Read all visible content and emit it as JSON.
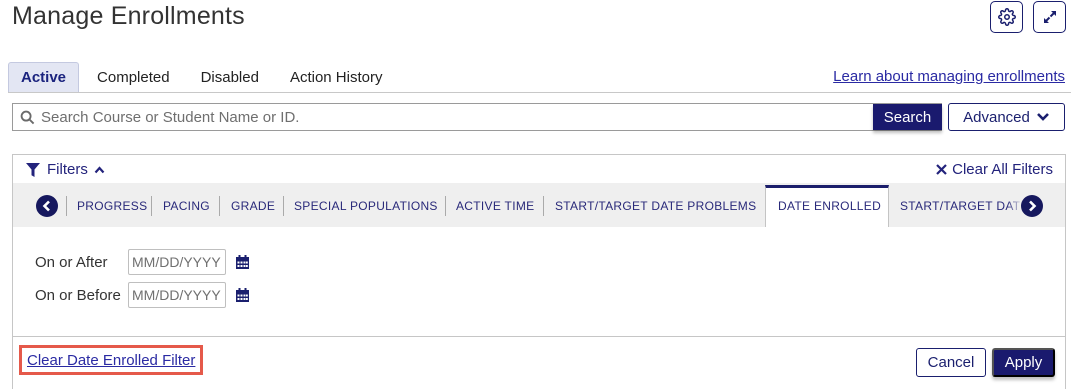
{
  "page": {
    "title": "Manage Enrollments"
  },
  "header_icons": {
    "settings": "gear-icon",
    "expand": "expand-icon"
  },
  "tabs": [
    {
      "label": "Active",
      "active": true
    },
    {
      "label": "Completed",
      "active": false
    },
    {
      "label": "Disabled",
      "active": false
    },
    {
      "label": "Action History",
      "active": false
    }
  ],
  "learn_link": "Learn about managing enrollments",
  "search": {
    "placeholder": "Search Course or Student Name or ID.",
    "value": "",
    "button_label": "Search",
    "advanced_label": "Advanced"
  },
  "filters": {
    "toggle_label": "Filters",
    "expanded": true,
    "clear_all_label": "Clear All Filters",
    "tabs": [
      {
        "label": "PROGRESS"
      },
      {
        "label": "PACING"
      },
      {
        "label": "GRADE"
      },
      {
        "label": "SPECIAL POPULATIONS"
      },
      {
        "label": "ACTIVE TIME"
      },
      {
        "label": "START/TARGET DATE PROBLEMS"
      },
      {
        "label": "DATE ENROLLED",
        "active": true
      },
      {
        "label": "START/TARGET DATE"
      }
    ],
    "date_enrolled": {
      "on_or_after_label": "On or After",
      "on_or_before_label": "On or Before",
      "date_placeholder": "MM/DD/YYYY",
      "on_or_after_value": "",
      "on_or_before_value": ""
    },
    "clear_date_label": "Clear Date Enrolled Filter",
    "cancel_label": "Cancel",
    "apply_label": "Apply"
  },
  "colors": {
    "primary": "#1a1a6e",
    "link": "#2a2aa3",
    "highlight_border": "#e5594a",
    "active_tab_bg": "#e3e6f3",
    "filter_bar_bg": "#efefef"
  }
}
